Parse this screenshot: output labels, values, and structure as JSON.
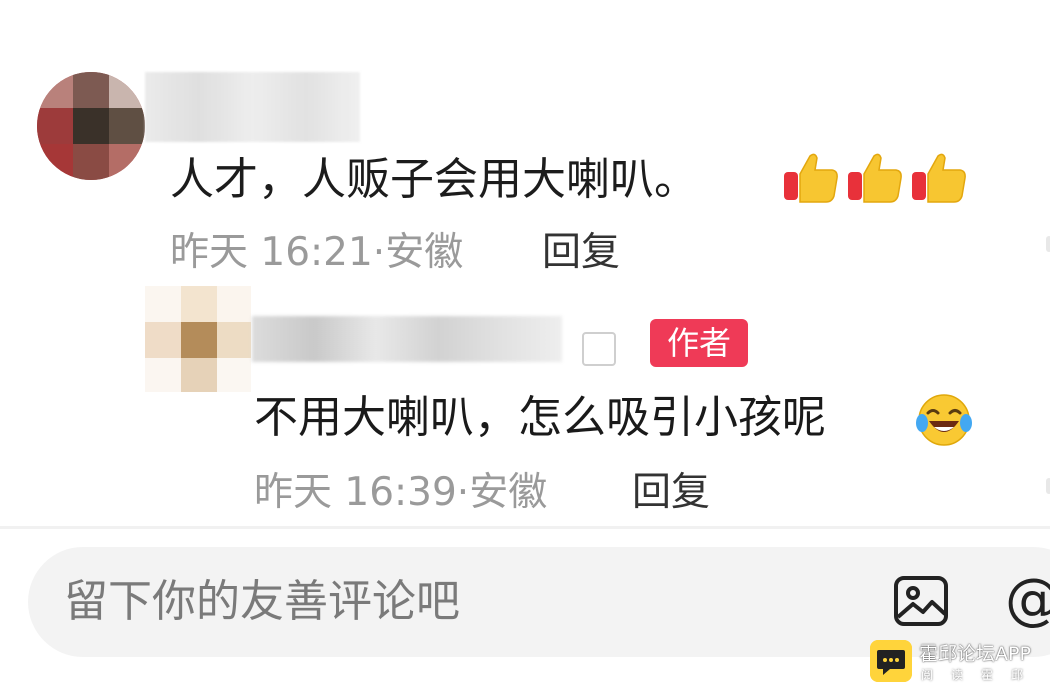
{
  "main_comment": {
    "text": "人才，人贩子会用大喇叭。",
    "reactions": [
      "thumbs-up-icon",
      "thumbs-up-icon",
      "thumbs-up-icon"
    ],
    "time": "昨天 16:21",
    "separator": "·",
    "location": "安徽",
    "reply_label": "回复"
  },
  "reply_comment": {
    "badge": "作者",
    "text": "不用大喇叭，怎么吸引小孩呢",
    "emoji": "laughing-tears-icon",
    "time": "昨天 16:39",
    "separator": "·",
    "location": "安徽",
    "reply_label": "回复"
  },
  "input_bar": {
    "placeholder": "留下你的友善评论吧",
    "icons": [
      "image-icon",
      "at-icon"
    ],
    "at_symbol": "@"
  },
  "watermark": {
    "title": "霍邱论坛APP",
    "subtitle": "阅读霍邱"
  },
  "colors": {
    "badge": "#ef3a57",
    "meta_text": "#9a9a9a",
    "input_bg": "#f3f3f3",
    "watermark_logo": "#ffd43b"
  }
}
